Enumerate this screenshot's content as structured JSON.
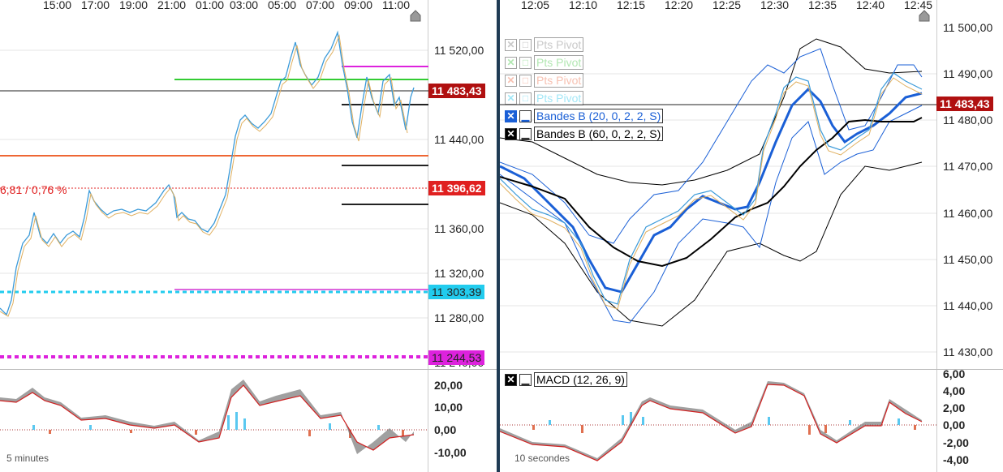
{
  "left": {
    "time_labels": [
      "15:00",
      "17:00",
      "19:00",
      "21:00",
      "01:00",
      "03:00",
      "05:00",
      "07:00",
      "09:00",
      "11:00"
    ],
    "price_labels": [
      "11 520,00",
      "11 440,00",
      "11 360,00",
      "11 320,00",
      "11 280,00",
      "11 240,00"
    ],
    "badges": {
      "current": {
        "text": "11 483,43",
        "color": "#b01010"
      },
      "prev_close": {
        "text": "11 396,62",
        "color": "#e02020"
      },
      "cyan": {
        "text": "11 303,39",
        "color": "#22ccee"
      },
      "magenta": {
        "text": "11 244,53",
        "color": "#dd22dd"
      }
    },
    "change_text": "6,81 / 0,76 %",
    "macd_labels": [
      "20,00",
      "10,00",
      "0,00",
      "-10,00"
    ],
    "timeframe": "5 minutes"
  },
  "right": {
    "time_labels": [
      "12:05",
      "12:10",
      "12:15",
      "12:20",
      "12:25",
      "12:30",
      "12:35",
      "12:40",
      "12:45"
    ],
    "price_labels": [
      "11 500,00",
      "11 490,00",
      "11 480,00",
      "11 470,00",
      "11 460,00",
      "11 450,00",
      "11 440,00",
      "11 430,00"
    ],
    "badge": {
      "text": "11 483,43",
      "color": "#b01010"
    },
    "legend": [
      {
        "label": "Pts Pivot",
        "icon": "x-icon",
        "dim": true,
        "color": "#888"
      },
      {
        "label": "Pts Pivot",
        "icon": "x-icon",
        "dim": true,
        "color": "#55cc55"
      },
      {
        "label": "Pts Pivot",
        "icon": "x-icon",
        "dim": true,
        "color": "#ee7755"
      },
      {
        "label": "Pts Pivot",
        "icon": "x-icon",
        "dim": true,
        "color": "#33ccee"
      },
      {
        "label": "Bandes B (20, 0, 2, 2, S)",
        "icon": "x-icon",
        "dim": false,
        "color": "#1a5fd6"
      },
      {
        "label": "Bandes B (60, 0, 2, 2, S)",
        "icon": "x-icon",
        "dim": false,
        "color": "#000"
      }
    ],
    "macd_legend": "MACD (12, 26, 9)",
    "macd_labels": [
      "6,00",
      "4,00",
      "2,00",
      "0,00",
      "-2,00",
      "-4,00"
    ],
    "timeframe": "10 secondes"
  }
}
